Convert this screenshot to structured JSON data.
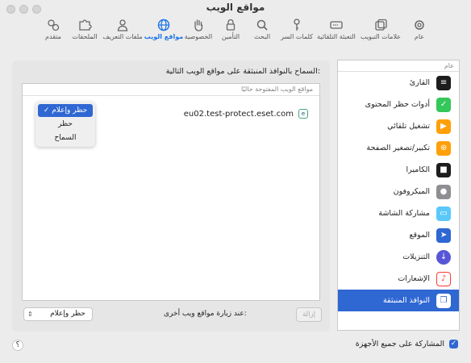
{
  "window": {
    "title": "مواقع الويب"
  },
  "toolbar": [
    {
      "id": "general",
      "label": "عام",
      "icon": "gear-icon"
    },
    {
      "id": "tabs",
      "label": "علامات التبويب",
      "icon": "tabs-icon"
    },
    {
      "id": "autofill",
      "label": "التعبئة التلقائية",
      "icon": "autofill-icon"
    },
    {
      "id": "passwords",
      "label": "كلمات السر",
      "icon": "key-icon"
    },
    {
      "id": "search",
      "label": "البحث",
      "icon": "search-icon"
    },
    {
      "id": "security",
      "label": "التأمين",
      "icon": "lock-icon"
    },
    {
      "id": "privacy",
      "label": "الخصوصية",
      "icon": "hand-icon"
    },
    {
      "id": "websites",
      "label": "مواقع الويب",
      "icon": "globe-icon"
    },
    {
      "id": "profiles",
      "label": "ملفات التعريف",
      "icon": "person-icon"
    },
    {
      "id": "extensions",
      "label": "الملحقات",
      "icon": "puzzle-icon"
    },
    {
      "id": "advanced",
      "label": "متقدم",
      "icon": "advanced-gear-icon"
    }
  ],
  "sidebar": {
    "header": "عام",
    "items": [
      {
        "label": "القارئ",
        "color": "#1d1d1d"
      },
      {
        "label": "أدوات حظر المحتوى",
        "color": "#34c759"
      },
      {
        "label": "تشغيل تلقائي",
        "color": "#ff9f0a"
      },
      {
        "label": "تكبير/تصغير الصفحة",
        "color": "#ff9f0a"
      },
      {
        "label": "الكاميرا",
        "color": "#1d1d1d"
      },
      {
        "label": "الميكروفون",
        "color": "#8e8e93"
      },
      {
        "label": "مشاركة الشاشة",
        "color": "#5ac8fa"
      },
      {
        "label": "الموقع",
        "color": "#2f67d3"
      },
      {
        "label": "التنزيلات",
        "color": "#5856d6"
      },
      {
        "label": "الإشعارات",
        "color": "#ff3b30"
      },
      {
        "label": "النوافذ المنبثقة",
        "color": "#2f67d3"
      }
    ]
  },
  "main": {
    "heading": "السماح بالنوافذ المنبثقة على مواقع الويب التالية:",
    "table_header": "مواقع الويب المفتوحة حاليًا",
    "site": "eu02.test-protect.eset.com",
    "dropdown_options": [
      "حظر وإعلام",
      "حظر",
      "السماح"
    ],
    "dropdown_selected_mark": "✓",
    "remove_label": "إزالة",
    "other_sites_label": "عند زيارة مواقع ويب أخرى:",
    "other_sites_value": "حظر وإعلام"
  },
  "footer": {
    "share_label": "المشاركة على جميع الأجهزة",
    "share_checked": true,
    "help_label": "؟"
  },
  "colors": {
    "accent": "#2f67d3"
  }
}
